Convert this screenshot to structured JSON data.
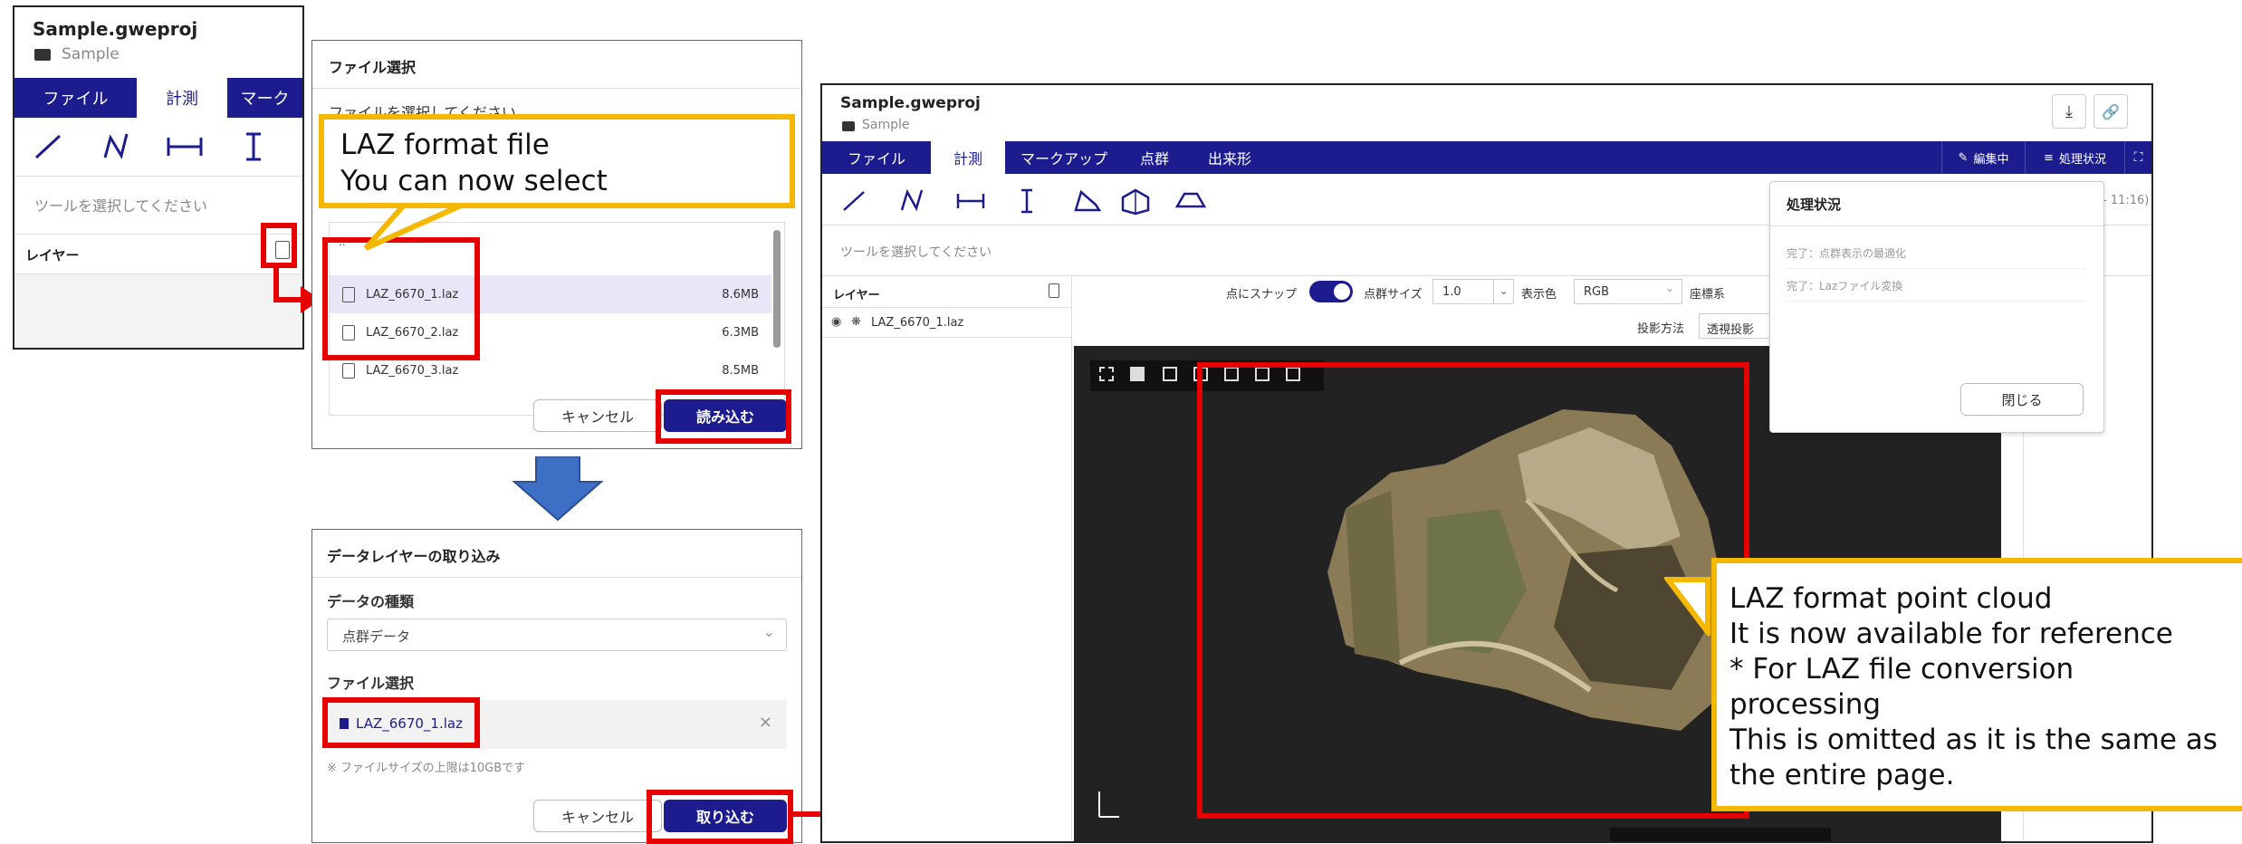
{
  "left_panel": {
    "title": "Sample.gweproj",
    "folder": "Sample",
    "tabs": [
      "ファイル",
      "計測",
      "マーク"
    ],
    "prompt": "ツールを選択してください",
    "layer_label": "レイヤー"
  },
  "file_select_dialog": {
    "title": "ファイル選択",
    "subtitle": "ファイルを選択してください",
    "files": [
      {
        "name": "LAZ_6670_1.laz",
        "size": "8.6MB"
      },
      {
        "name": "LAZ_6670_2.laz",
        "size": "6.3MB"
      },
      {
        "name": "LAZ_6670_3.laz",
        "size": "8.5MB"
      }
    ],
    "cancel": "キャンセル",
    "load": "読み込む"
  },
  "import_dialog": {
    "title": "データレイヤーの取り込み",
    "data_type_label": "データの種類",
    "data_type_value": "点群データ",
    "file_select_label": "ファイル選択",
    "selected_file": "LAZ_6670_1.laz",
    "remove": "×",
    "note": "※ ファイルサイズの上限は10GBです",
    "cancel": "キャンセル",
    "import": "取り込む"
  },
  "main_app": {
    "title": "Sample.gweproj",
    "folder": "Sample",
    "tabs": [
      "ファイル",
      "計測",
      "マークアップ",
      "点群",
      "出来形"
    ],
    "edit_button": "編集中",
    "status_button": "処理状況",
    "prompt": "ツールを選択してください",
    "layer_label": "レイヤー",
    "layer_item": "LAZ_6670_1.laz",
    "snap_label": "点にスナップ",
    "point_size_label": "点群サイズ",
    "point_size_value": "1.0",
    "display_color_label": "表示色",
    "display_color_value": "RGB",
    "coord_label": "座標系",
    "projection_label": "投影方法",
    "projection_value": "透視投影",
    "time_fragment": "- 11:16)"
  },
  "status_popup": {
    "title": "処理状況",
    "items": [
      "完了：点群表示の最適化",
      "完了：Lazファイル変換"
    ],
    "close": "閉じる"
  },
  "callouts": {
    "laz_select": [
      "LAZ format file",
      "You can now select"
    ],
    "laz_cloud": [
      "LAZ format point cloud",
      "It is now available for reference",
      "* For LAZ file conversion",
      "processing",
      "This is omitted as it is the same as",
      "the entire page."
    ]
  },
  "colors": {
    "brand": "#1c1c8f",
    "highlight": "#e60000",
    "callout_border": "#f5b800",
    "arrow": "#3d6fc4"
  }
}
